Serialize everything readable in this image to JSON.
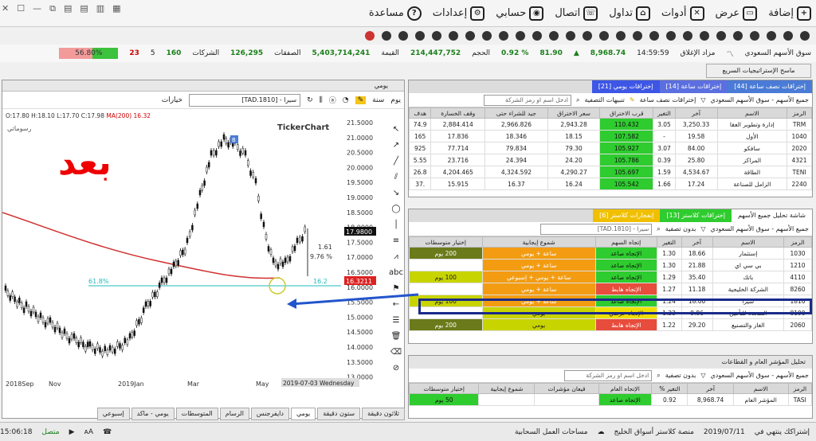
{
  "menu": {
    "items": [
      {
        "label": "إضافة",
        "icon": "add-icon"
      },
      {
        "label": "عرض",
        "icon": "view-icon"
      },
      {
        "label": "أدوات",
        "icon": "tools-icon"
      },
      {
        "label": "تداول",
        "icon": "trade-icon"
      },
      {
        "label": "اتصال",
        "icon": "connect-icon"
      },
      {
        "label": "حسابي",
        "icon": "account-icon"
      },
      {
        "label": "إعدادات",
        "icon": "settings-icon"
      },
      {
        "label": "مساعدة",
        "icon": "help-icon"
      }
    ]
  },
  "ticker": {
    "market": "سوق الأسهم السعودي",
    "status": "مزاد الإغلاق",
    "time": "14:59:59",
    "index": "8,968.74",
    "change": "81.90",
    "pct": "0.92 %",
    "volume_label": "الحجم",
    "volume": "214,447,752",
    "value_label": "القيمة",
    "value": "5,403,714,241",
    "deals_label": "الصفقات",
    "deals": "126,295",
    "companies_label": "الشركات",
    "up": "160",
    "flat": "5",
    "down": "23",
    "pct_box": "56.80%",
    "pct_up": 0.568
  },
  "scan_button": "ماسح الإستراتيجيات السريع",
  "chart": {
    "window_title": "يومي",
    "symbol": "[TAD.1810] - سيرا",
    "period": "يوم",
    "range": "سنة",
    "options": "خيارات",
    "info": "O:17.80 H:18.10 L:17.70 C:17.98",
    "ma": "MA(200) 16.32",
    "watermark": "TickerChart",
    "drawings": "رسوماتي",
    "overlay_text": "بعد",
    "fib_label": "61.8%",
    "fib_value": "16.2",
    "measure_a": "1.61",
    "measure_b": "9.76 %",
    "price_tag": "17.9800",
    "ma_tag": "16.3211",
    "date_tag": "2019-07-03 Wednesday",
    "marker": "B",
    "yticks": [
      "21.5000",
      "21.0000",
      "20.5000",
      "20.0000",
      "19.5000",
      "19.0000",
      "18.5000",
      "18.0000",
      "17.5000",
      "17.0000",
      "16.5000",
      "16.0000",
      "15.5000",
      "15.0000",
      "14.5000",
      "14.0000",
      "13.5000",
      "13.0000"
    ],
    "xticks": [
      "2018Sep",
      "Nov",
      "2019Jan",
      "Mar",
      "May"
    ]
  },
  "bottom_tabs": [
    "ثلاثون دقيقة",
    "ستون دقيقة",
    "يومي",
    "دايفرجنس",
    "الرسام",
    "المتوسطات",
    "يومي - ماكد",
    "إسبوعي"
  ],
  "panel1": {
    "tabs": [
      "إختراقات نصف ساعة [44]",
      "إختراقات ساعة [14]",
      "إختراقات يومي [21]"
    ],
    "market": "جميع الأسهم - سوق الأسهم السعودي",
    "filter": "إختراقات نصف ساعة",
    "alerts": "تنبيهات التصفية",
    "search": "ادخل اسم او رمز الشركة",
    "headers": [
      "الرمز",
      "الاسم",
      "آخر",
      "التغير",
      "قرب الاختراق",
      "سعر الاختراق",
      "جيد للشراء حتى",
      "وقف الخسارة",
      "هدف"
    ],
    "rows": [
      [
        "TRM",
        "إدارة وتطوير العقا",
        "3,250.33",
        "3.05",
        "110.432",
        "2,943.28",
        "2,966.826",
        "2,884.414",
        "74.9"
      ],
      [
        "1040",
        "الأول",
        "19.58",
        "-",
        "107.582",
        "18.15",
        "18.346",
        "17.836",
        "165"
      ],
      [
        "2020",
        "سافكو",
        "84.00",
        "3.07",
        "105.927",
        "79.30",
        "79.834",
        "77.714",
        "925"
      ],
      [
        "4321",
        "المراكز",
        "25.80",
        "0.39",
        "105.786",
        "24.20",
        "24.394",
        "23.716",
        "5.55"
      ],
      [
        "TENI",
        "الطاقة",
        "4,534.67",
        "1.59",
        "105.697",
        "4,290.27",
        "4,324.592",
        "4,204.465",
        "26.8"
      ],
      [
        "2240",
        "الزامل للصناعة",
        "17.24",
        "1.66",
        "105.542",
        "16.24",
        "16.37",
        "15.915",
        ".37"
      ]
    ]
  },
  "panel2": {
    "tabs": [
      "شاشة تحليل جميع الأسهم",
      "إختراقات كلاستر [13]",
      "إنفجارات كلاستر [6]"
    ],
    "market": "جميع الأسهم - سوق الأسهم السعودي",
    "filter": "بدون تصفية",
    "symbol": "[TAD.1810] - سيرا",
    "headers": [
      "الرمز",
      "الاسم",
      "آخر",
      "التغير",
      "إتجاه السهم",
      "شموع إيجابية",
      "إختيار متوسطات"
    ],
    "rows": [
      [
        "1030",
        "إستثمار",
        "18.66",
        "1.30",
        "الإتجاه صاعد",
        "ساعة + يومي",
        "200 يوم"
      ],
      [
        "1210",
        "بي سي اي",
        "21.88",
        "1.30",
        "الإتجاه صاعد",
        "ساعة + يومي",
        ""
      ],
      [
        "4110",
        "باتك",
        "35.40",
        "1.29",
        "الإتجاه صاعد",
        "ساعة + يومي + إسبوعي",
        "100 يوم"
      ],
      [
        "8260",
        "الشركة الخليجية",
        "11.18",
        "1.27",
        "الإتجاه هابط",
        "ساعة + يومي",
        ""
      ],
      [
        "1810",
        "سيرا",
        "18.00",
        "1.24",
        "الإتجاه صاعد",
        "ساعة + يومي",
        "100 يوم"
      ],
      [
        "8190",
        "المتحدة للتأمين",
        "9.86",
        "1.23",
        "الإتجاه عرضي",
        "يومي",
        ""
      ],
      [
        "2060",
        "الغاز والتصنيع",
        "29.20",
        "1.22",
        "الإتجاه هابط",
        "يومي",
        "200 يوم"
      ]
    ]
  },
  "panel3": {
    "title": "تحليل المؤشر العام و القطاعات",
    "market": "جميع الأسهم - سوق الأسهم السعودي",
    "filter": "بدون تصفية",
    "search": "ادخل اسم او رمز الشركة",
    "headers": [
      "الرمز",
      "الاسم",
      "آخر",
      "التغير %",
      "الإتجاه العام",
      "قيعان مؤشرات",
      "شموع إيجابية",
      "إختيار متوسطات"
    ],
    "rows": [
      [
        "TASI",
        "المؤشر العام",
        "8,968.74",
        "0.92",
        "الإتجاه صاعد",
        "",
        "",
        "50 يوم"
      ]
    ]
  },
  "status": {
    "subscription": "إشتراكك ينتهي في",
    "date": "2019/07/11",
    "platform": "منصة كلاستر أسواق الخليج",
    "cloud": "مساحات العمل السحابية",
    "connected": "متصل",
    "clock": "15:06:18"
  }
}
